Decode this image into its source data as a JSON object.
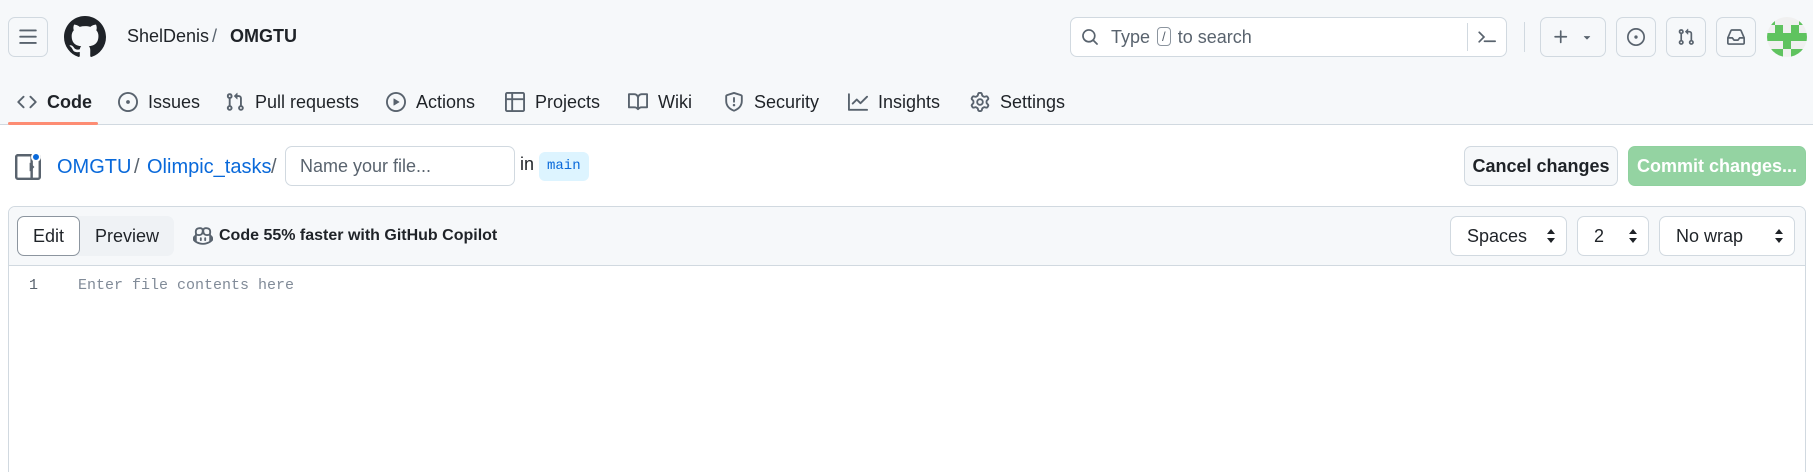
{
  "header": {
    "owner": "ShelDenis",
    "separator": "/",
    "repo": "OMGTU",
    "search": {
      "prefix": "Type",
      "key": "/",
      "suffix": "to search"
    }
  },
  "tabs": [
    {
      "label": "Code",
      "icon": "code-icon",
      "active": true
    },
    {
      "label": "Issues",
      "icon": "issue-opened-icon"
    },
    {
      "label": "Pull requests",
      "icon": "git-pull-request-icon"
    },
    {
      "label": "Actions",
      "icon": "play-icon"
    },
    {
      "label": "Projects",
      "icon": "table-icon"
    },
    {
      "label": "Wiki",
      "icon": "book-icon"
    },
    {
      "label": "Security",
      "icon": "shield-icon"
    },
    {
      "label": "Insights",
      "icon": "graph-icon"
    },
    {
      "label": "Settings",
      "icon": "gear-icon"
    }
  ],
  "edit_bar": {
    "path_root": "OMGTU",
    "path_folder": "Olimpic_tasks",
    "separator": "/",
    "filename_placeholder": "Name your file...",
    "in_label": "in",
    "branch": "main",
    "cancel_label": "Cancel changes",
    "commit_label": "Commit changes..."
  },
  "editor": {
    "edit_label": "Edit",
    "preview_label": "Preview",
    "copilot_text": "Code 55% faster with GitHub Copilot",
    "indent_mode": "Spaces",
    "indent_size": "2",
    "wrap_mode": "No wrap",
    "line_number": "1",
    "placeholder": "Enter file contents here"
  },
  "colors": {
    "accent_link": "#0969da",
    "tab_underline": "#fd8c73",
    "commit_disabled": "#94d3a2",
    "notification_dot": "#0969da"
  }
}
